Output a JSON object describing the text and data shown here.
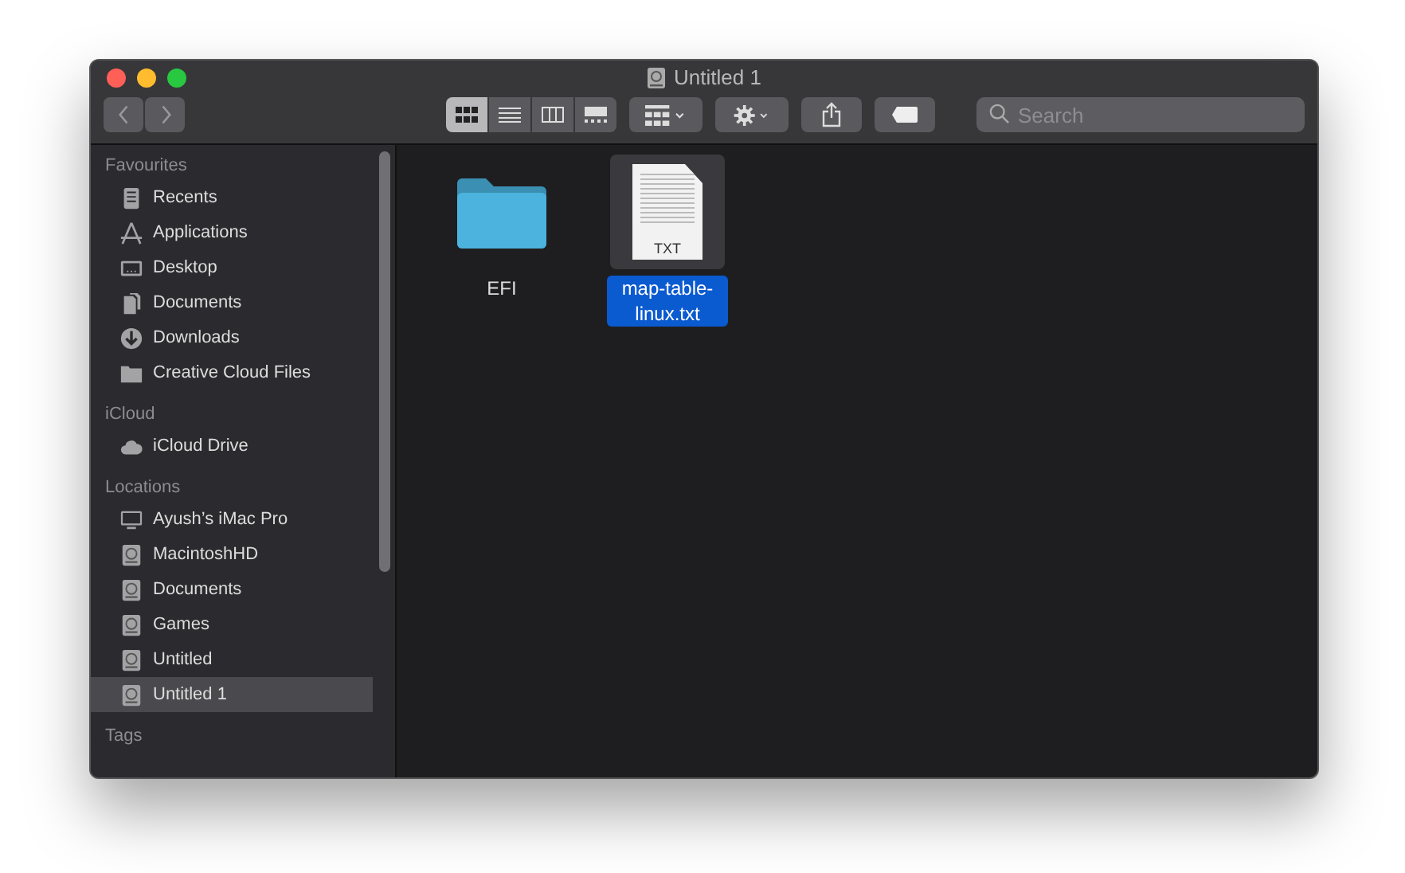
{
  "window": {
    "title": "Untitled 1"
  },
  "toolbar": {
    "view_modes": [
      {
        "kind": "icons",
        "selected": true
      },
      {
        "kind": "list",
        "selected": false
      },
      {
        "kind": "columns",
        "selected": false
      },
      {
        "kind": "gallery",
        "selected": false
      }
    ],
    "search": {
      "placeholder": "Search"
    }
  },
  "sidebar": {
    "sections": [
      {
        "title": "Favourites",
        "items": [
          {
            "label": "Recents",
            "kind": "recents",
            "selected": false
          },
          {
            "label": "Applications",
            "kind": "applications",
            "selected": false
          },
          {
            "label": "Desktop",
            "kind": "desktop",
            "selected": false
          },
          {
            "label": "Documents",
            "kind": "documents",
            "selected": false
          },
          {
            "label": "Downloads",
            "kind": "downloads",
            "selected": false
          },
          {
            "label": "Creative Cloud Files",
            "kind": "folder",
            "selected": false
          }
        ]
      },
      {
        "title": "iCloud",
        "items": [
          {
            "label": "iCloud Drive",
            "kind": "cloud",
            "selected": false
          }
        ]
      },
      {
        "title": "Locations",
        "items": [
          {
            "label": "Ayush’s iMac Pro",
            "kind": "computer",
            "selected": false
          },
          {
            "label": "MacintoshHD",
            "kind": "disk",
            "selected": false
          },
          {
            "label": "Documents",
            "kind": "disk",
            "selected": false
          },
          {
            "label": "Games",
            "kind": "disk",
            "selected": false
          },
          {
            "label": "Untitled",
            "kind": "disk",
            "selected": false
          },
          {
            "label": "Untitled 1",
            "kind": "disk",
            "selected": true
          }
        ]
      },
      {
        "title": "Tags"
      }
    ]
  },
  "files": [
    {
      "name": "EFI",
      "kind": "folder",
      "selected": false
    },
    {
      "name": "map-table-linux.txt",
      "kind": "text",
      "badge": "TXT",
      "selected": true
    }
  ]
}
